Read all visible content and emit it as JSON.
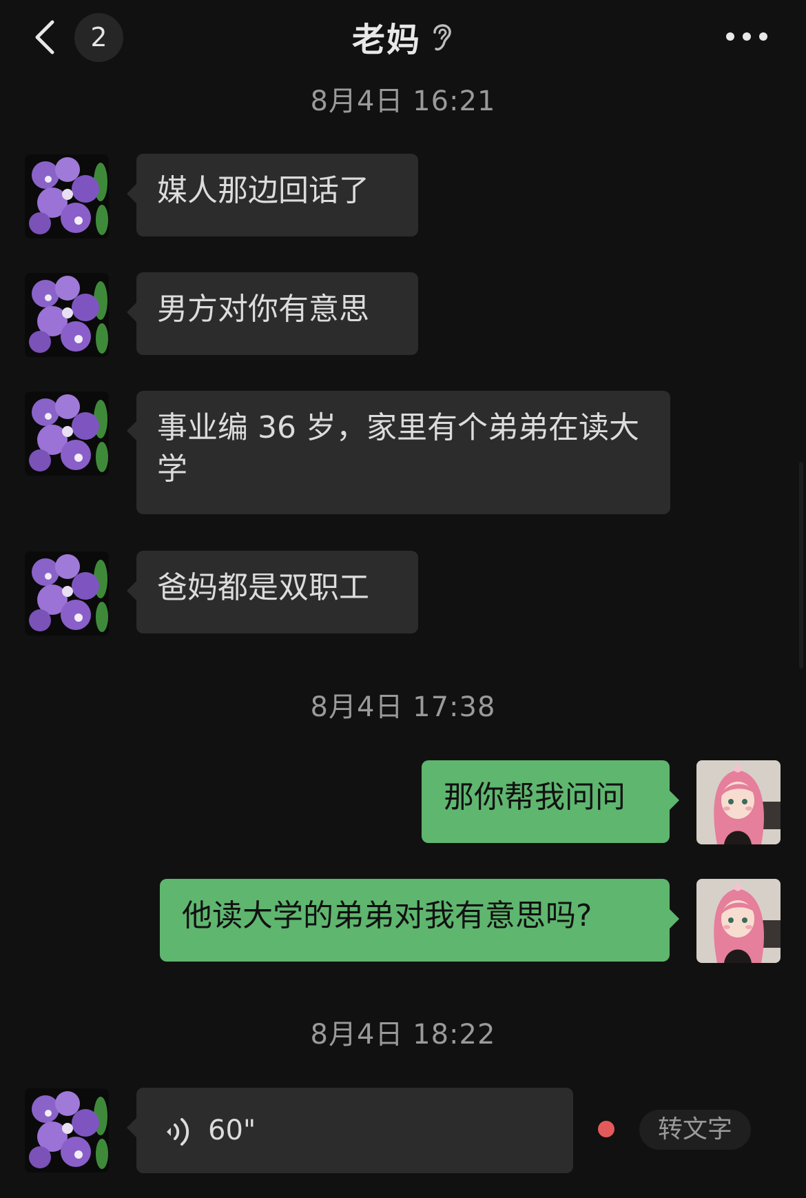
{
  "header": {
    "title": "老妈",
    "unread_count": "2",
    "icons": {
      "back": "chevron-left-icon",
      "earpiece": "ear-icon",
      "more": "more-dots-icon"
    }
  },
  "colors": {
    "background": "#111111",
    "incoming_bubble": "#2c2c2c",
    "outgoing_bubble": "#5fb66f",
    "unread_dot": "#e45a5a"
  },
  "timestamps": [
    "8月4日 16:21",
    "8月4日 17:38",
    "8月4日 18:22"
  ],
  "messages": [
    {
      "sender": "contact",
      "text": "媒人那边回话了"
    },
    {
      "sender": "contact",
      "text": "男方对你有意思"
    },
    {
      "sender": "contact",
      "text": "事业编 36 岁，家里有个弟弟在读大学"
    },
    {
      "sender": "contact",
      "text": "爸妈都是双职工"
    },
    {
      "sender": "me",
      "text": "那你帮我问问"
    },
    {
      "sender": "me",
      "text": "他读大学的弟弟对我有意思吗?"
    }
  ],
  "voice_message": {
    "sender": "contact",
    "duration": "60\"",
    "icon": "voice-wave-icon",
    "convert_label": "转文字"
  }
}
